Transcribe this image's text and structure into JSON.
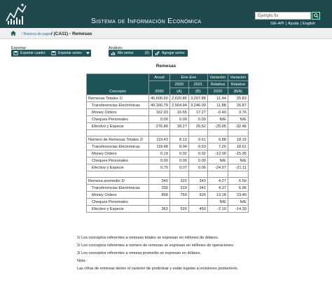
{
  "header": {
    "title": "Sistema de Información Económica",
    "search_placeholder": "Ejemplo fix",
    "links": [
      "SIE-API",
      "Ayuda",
      "English"
    ]
  },
  "breadcrumb": {
    "parent": "Balanza de pagos",
    "current": "(CA11) - Remesas"
  },
  "toolbar": {
    "export_label": "Exportar:",
    "export_table": "Exportar cuadro",
    "export_series": "Exportar series",
    "analysis_label": "Análisis:",
    "my_series": "Mis series",
    "my_series_count": "(0)",
    "add_chart": "Agregar series"
  },
  "table": {
    "title": "Remesas",
    "header": {
      "concepto": "Concepto",
      "anual": "Anual",
      "ene_ene": "Ene-Ene",
      "variacion": "Variación",
      "y2020": "2020",
      "y2021": "2021",
      "a": "(A)",
      "b": "(B)",
      "relativa": "Relativa",
      "relativa_2020": "2020",
      "relativa_ba": "(B/A)"
    },
    "sections": [
      {
        "rows": [
          {
            "concept": "Remesas Totales 1/",
            "indent": false,
            "v": [
              "40,606.60",
              "2,620.86",
              "3,297.88",
              "11.44",
              "25.83"
            ]
          },
          {
            "concept": "Transferencias Electrónicas",
            "indent": true,
            "v": [
              "40,166.79",
              "2,564.94",
              "3,246.09",
              "11.88",
              "26.87"
            ]
          },
          {
            "concept": "Money Orders",
            "indent": true,
            "v": [
              "162.93",
              "16.65",
              "17.27",
              "-0.40",
              "3.76"
            ]
          },
          {
            "concept": "Cheques Personales",
            "indent": true,
            "v": [
              "0.00",
              "0.00",
              "0.00",
              "N/E",
              "N/E"
            ]
          },
          {
            "concept": "Efectivo y Especie",
            "indent": true,
            "v": [
              "276.89",
              "39.27",
              "26.52",
              "-25.95",
              "-32.46"
            ]
          }
        ]
      },
      {
        "rows": [
          {
            "concept": "Número de Remesas Totales 2/",
            "indent": false,
            "v": [
              "119.43",
              "8.13",
              "9.61",
              "6.88",
              "18.15"
            ]
          },
          {
            "concept": "Transferencias Electrónicas",
            "indent": true,
            "v": [
              "118.48",
              "8.04",
              "9.53",
              "7.20",
              "18.61"
            ]
          },
          {
            "concept": "Money Orders",
            "indent": true,
            "v": [
              "0.19",
              "0.02",
              "0.02",
              "-12.00",
              "-15.95"
            ]
          },
          {
            "concept": "Cheques Personales",
            "indent": true,
            "v": [
              "0.00",
              "0.00",
              "0.00",
              "N/E",
              "N/E"
            ]
          },
          {
            "concept": "Efectivo y Especie",
            "indent": true,
            "v": [
              "0.76",
              "0.07",
              "0.06",
              "-24.97",
              "-21.11"
            ]
          }
        ]
      },
      {
        "rows": [
          {
            "concept": "Remesa promedio 3/",
            "indent": false,
            "v": [
              "340",
              "322",
              "343",
              "4.27",
              "6.50"
            ]
          },
          {
            "concept": "Transferencias Electrónicas",
            "indent": true,
            "v": [
              "339",
              "319",
              "341",
              "4.37",
              "6.96"
            ]
          },
          {
            "concept": "Money Orders",
            "indent": true,
            "v": [
              "868",
              "750",
              "926",
              "13.18",
              "23.46"
            ]
          },
          {
            "concept": "Cheques Personales",
            "indent": true,
            "v": [
              "",
              "",
              "",
              "N/E",
              "N/E"
            ]
          },
          {
            "concept": "Efectivo y Especie",
            "indent": true,
            "v": [
              "363",
              "526",
              "450",
              "-2.10",
              "-14.39"
            ]
          }
        ]
      }
    ]
  },
  "footnotes": [
    "1/ Los conceptos referentes a remesas totales se expresan en millones de dólares.",
    "2/ Los conceptos referentes a número de remesas se expresan en millones de operaciones.",
    "3/ Los conceptos referentes a remesa promedio se expresan en dólares.",
    "Nota:",
    "Las cifras de remesas tienen el carácter de preliminar y están sujetas a revisiones posteriores."
  ]
}
